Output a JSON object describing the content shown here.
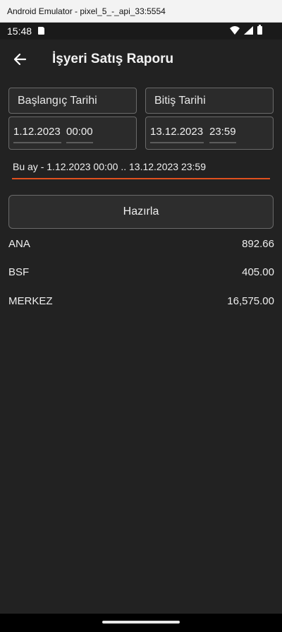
{
  "window": {
    "title": "Android Emulator - pixel_5_-_api_33:5554"
  },
  "status_bar": {
    "time": "15:48"
  },
  "app_bar": {
    "title": "İşyeri Satış Raporu"
  },
  "filters": {
    "start_label": "Başlangıç Tarihi",
    "end_label": "Bitiş Tarihi",
    "start_date": "1.12.2023",
    "start_time": "00:00",
    "end_date": "13.12.2023",
    "end_time": "23:59",
    "range_text": "Bu ay - 1.12.2023 00:00 .. 13.12.2023 23:59"
  },
  "actions": {
    "prepare_label": "Hazırla"
  },
  "results": [
    {
      "name": "ANA",
      "value": "892.66"
    },
    {
      "name": "BSF",
      "value": "405.00"
    },
    {
      "name": "MERKEZ",
      "value": "16,575.00"
    }
  ],
  "colors": {
    "accent": "#e0501e",
    "background": "#222222"
  }
}
